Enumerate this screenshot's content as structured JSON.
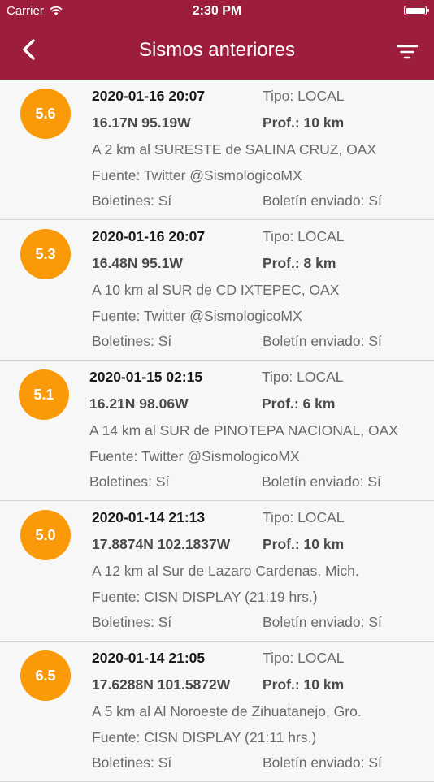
{
  "status_bar": {
    "carrier": "Carrier",
    "time": "2:30 PM"
  },
  "navbar": {
    "title": "Sismos anteriores"
  },
  "colors": {
    "header": "#9c1e3c",
    "magnitude_badge": "#fb9a08"
  },
  "quakes": [
    {
      "magnitude": "5.6",
      "datetime": "2020-01-16 20:07",
      "type": "Tipo: LOCAL",
      "coords": "16.17N 95.19W",
      "depth": "Prof.: 10 km",
      "location": "A 2 km al SURESTE de SALINA CRUZ, OAX",
      "source": "Fuente: Twitter @SismologicoMX",
      "bulletins": "Boletines: Sí",
      "bulletin_sent": "Boletín enviado: Sí"
    },
    {
      "magnitude": "5.3",
      "datetime": "2020-01-16 20:07",
      "type": "Tipo: LOCAL",
      "coords": "16.48N 95.1W",
      "depth": "Prof.: 8 km",
      "location": "A 10 km al SUR de CD IXTEPEC, OAX",
      "source": "Fuente: Twitter @SismologicoMX",
      "bulletins": "Boletines: Sí",
      "bulletin_sent": "Boletín enviado: Sí"
    },
    {
      "magnitude": "5.1",
      "datetime": "2020-01-15 02:15",
      "type": "Tipo: LOCAL",
      "coords": "16.21N 98.06W",
      "depth": "Prof.: 6 km",
      "location": "A 14 km al SUR de PINOTEPA NACIONAL, OAX",
      "source": "Fuente: Twitter @SismologicoMX",
      "bulletins": "Boletines: Sí",
      "bulletin_sent": "Boletín enviado: Sí"
    },
    {
      "magnitude": "5.0",
      "datetime": "2020-01-14 21:13",
      "type": "Tipo: LOCAL",
      "coords": "17.8874N 102.1837W",
      "depth": "Prof.: 10 km",
      "location": "A 12 km al Sur de Lazaro Cardenas, Mich.",
      "source": "Fuente: CISN DISPLAY (21:19 hrs.)",
      "bulletins": "Boletines: Sí",
      "bulletin_sent": "Boletín enviado: Sí"
    },
    {
      "magnitude": "6.5",
      "datetime": "2020-01-14 21:05",
      "type": "Tipo: LOCAL",
      "coords": "17.6288N 101.5872W",
      "depth": "Prof.: 10 km",
      "location": "A 5 km al Al Noroeste de Zihuatanejo, Gro.",
      "source": "Fuente: CISN DISPLAY (21:11 hrs.)",
      "bulletins": "Boletines: Sí",
      "bulletin_sent": "Boletín enviado: Sí"
    }
  ]
}
